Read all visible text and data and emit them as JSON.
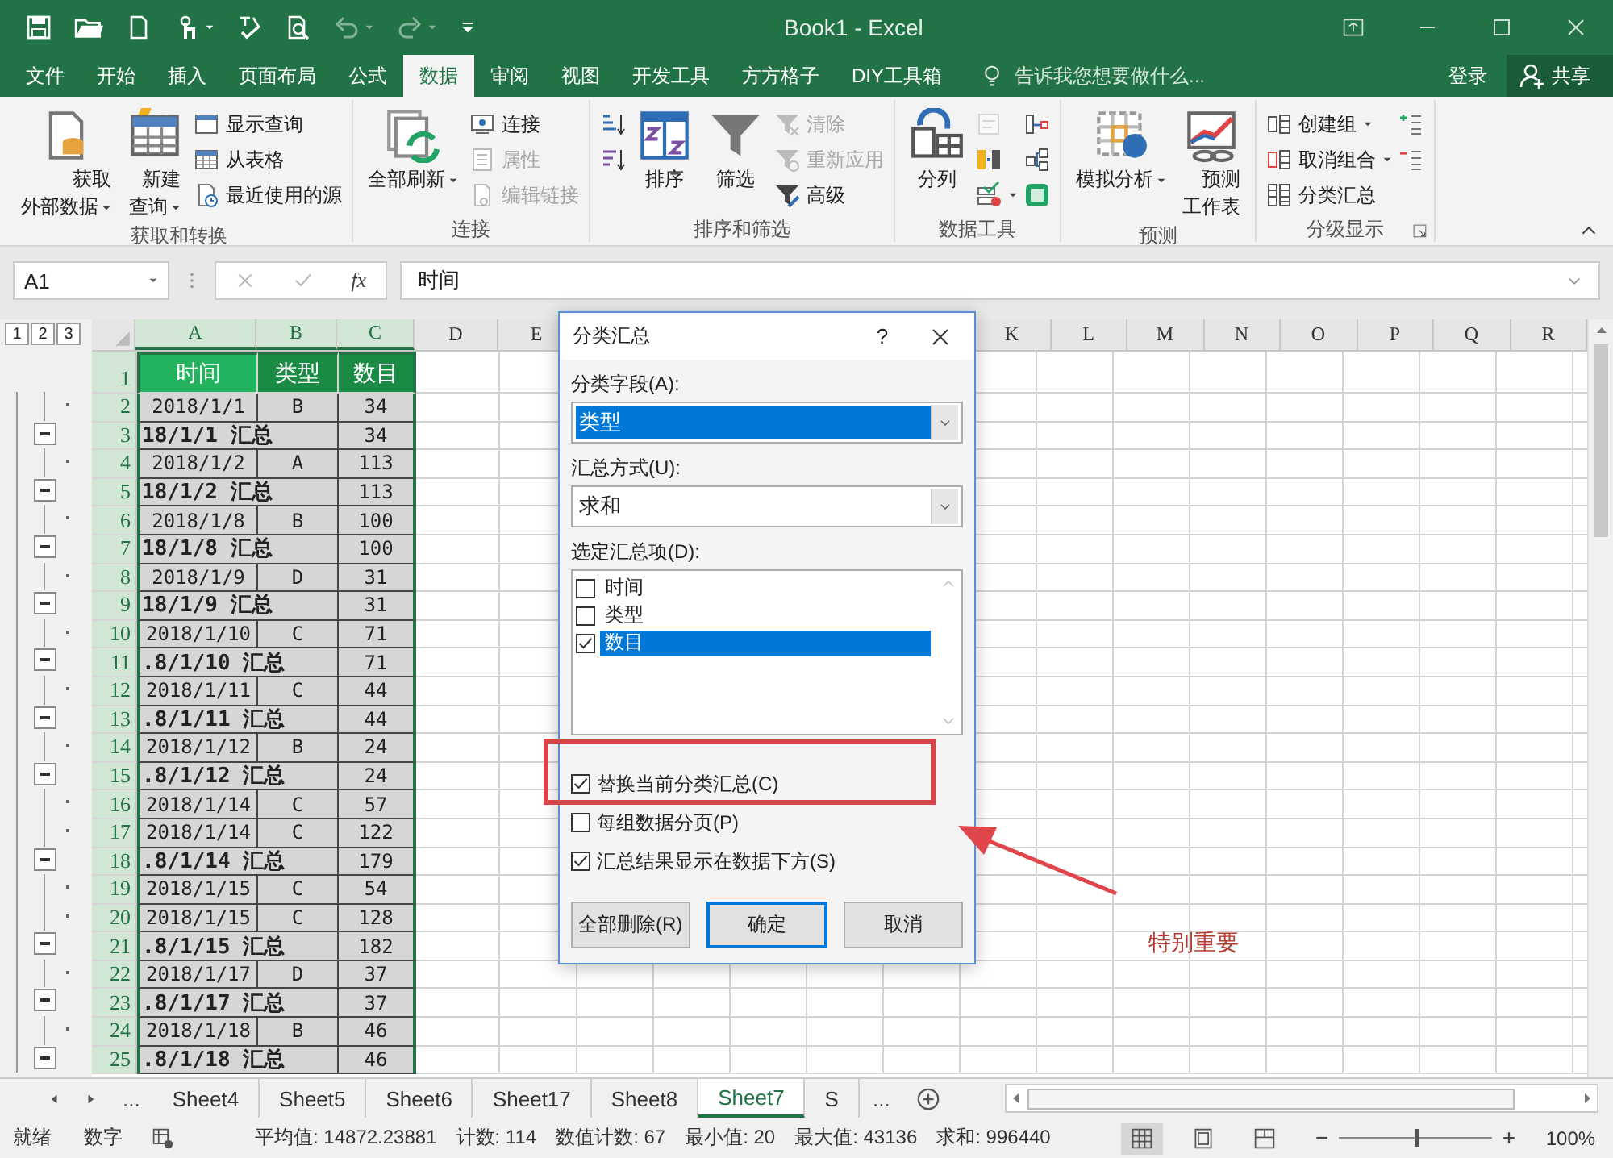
{
  "window": {
    "title": "Book1 - Excel"
  },
  "ribbon_tabs": [
    {
      "label": "文件",
      "selected": false
    },
    {
      "label": "开始",
      "selected": false
    },
    {
      "label": "插入",
      "selected": false
    },
    {
      "label": "页面布局",
      "selected": false
    },
    {
      "label": "公式",
      "selected": false
    },
    {
      "label": "数据",
      "selected": true
    },
    {
      "label": "审阅",
      "selected": false
    },
    {
      "label": "视图",
      "selected": false
    },
    {
      "label": "开发工具",
      "selected": false
    },
    {
      "label": "方方格子",
      "selected": false
    },
    {
      "label": "DIY工具箱",
      "selected": false
    }
  ],
  "tell_me": {
    "placeholder": "告诉我您想要做什么..."
  },
  "account": {
    "sign_in": "登录",
    "share": "共享"
  },
  "ribbon": {
    "groups": [
      {
        "label": "获取和转换",
        "items": [
          {
            "kind": "large",
            "lines": [
              "获取",
              "外部数据"
            ],
            "dropdown": true,
            "disabled": false
          },
          {
            "kind": "large",
            "lines": [
              "新建",
              "查询"
            ],
            "dropdown": true,
            "disabled": false
          },
          {
            "kind": "small",
            "label": "显示查询",
            "dropdown": false,
            "disabled": false
          },
          {
            "kind": "small",
            "label": "从表格",
            "dropdown": false,
            "disabled": false
          },
          {
            "kind": "small",
            "label": "最近使用的源",
            "dropdown": false,
            "disabled": false
          }
        ]
      },
      {
        "label": "连接",
        "items": [
          {
            "kind": "large",
            "lines": [
              "全部刷新"
            ],
            "dropdown": true,
            "disabled": false
          },
          {
            "kind": "small",
            "label": "连接",
            "dropdown": false,
            "disabled": false
          },
          {
            "kind": "small",
            "label": "属性",
            "dropdown": false,
            "disabled": true
          },
          {
            "kind": "small",
            "label": "编辑链接",
            "dropdown": false,
            "disabled": true
          }
        ]
      },
      {
        "label": "排序和筛选",
        "items": [
          {
            "kind": "icon",
            "dropdown": false,
            "disabled": false
          },
          {
            "kind": "icon",
            "dropdown": false,
            "disabled": false
          },
          {
            "kind": "large",
            "lines": [
              "排序"
            ],
            "dropdown": false,
            "disabled": false
          },
          {
            "kind": "large",
            "lines": [
              "筛选"
            ],
            "dropdown": false,
            "disabled": false
          },
          {
            "kind": "small",
            "label": "清除",
            "dropdown": false,
            "disabled": true
          },
          {
            "kind": "small",
            "label": "重新应用",
            "dropdown": false,
            "disabled": true
          },
          {
            "kind": "small",
            "label": "高级",
            "dropdown": false,
            "disabled": false
          }
        ]
      },
      {
        "label": "数据工具",
        "items": [
          {
            "kind": "large",
            "lines": [
              "分列"
            ],
            "dropdown": false,
            "disabled": false
          },
          {
            "kind": "icon",
            "dropdown": false,
            "disabled": true
          },
          {
            "kind": "icon",
            "dropdown": false,
            "disabled": false
          },
          {
            "kind": "icon",
            "dropdown": true,
            "disabled": false
          },
          {
            "kind": "icon",
            "dropdown": false,
            "disabled": false
          },
          {
            "kind": "icon",
            "dropdown": false,
            "disabled": false
          },
          {
            "kind": "icon",
            "dropdown": false,
            "disabled": false
          }
        ]
      },
      {
        "label": "预测",
        "items": [
          {
            "kind": "large",
            "lines": [
              "模拟分析"
            ],
            "dropdown": true,
            "disabled": false
          },
          {
            "kind": "large",
            "lines": [
              "预测",
              "工作表"
            ],
            "dropdown": false,
            "disabled": false
          }
        ]
      },
      {
        "label": "分级显示",
        "launcher": true,
        "items": [
          {
            "kind": "small",
            "label": "创建组",
            "dropdown": true,
            "disabled": false
          },
          {
            "kind": "small",
            "label": "取消组合",
            "dropdown": true,
            "disabled": false
          },
          {
            "kind": "small",
            "label": "分类汇总",
            "dropdown": false,
            "disabled": false
          },
          {
            "kind": "icon",
            "dropdown": false,
            "disabled": false
          },
          {
            "kind": "icon",
            "dropdown": false,
            "disabled": false
          }
        ]
      }
    ]
  },
  "formula_bar": {
    "name_box": "A1",
    "fx": "fx",
    "value": "时间"
  },
  "sheet": {
    "outline_levels": [
      "1",
      "2",
      "3"
    ],
    "columns": [
      {
        "label": "A",
        "selected": true
      },
      {
        "label": "B",
        "selected": true
      },
      {
        "label": "C",
        "selected": true
      },
      {
        "label": "D",
        "selected": false
      },
      {
        "label": "E",
        "selected": false
      },
      {
        "label": "K",
        "selected": false
      },
      {
        "label": "L",
        "selected": false
      },
      {
        "label": "M",
        "selected": false
      },
      {
        "label": "N",
        "selected": false
      },
      {
        "label": "O",
        "selected": false
      },
      {
        "label": "P",
        "selected": false
      },
      {
        "label": "Q",
        "selected": false
      },
      {
        "label": "R",
        "selected": false
      }
    ],
    "header_row": {
      "row": "1",
      "selected": true,
      "cells": [
        "时间",
        "类型",
        "数目"
      ]
    },
    "rows": [
      {
        "row": "2",
        "kind": "detail",
        "selected": true,
        "cells": [
          "2018/1/1",
          "B",
          "34"
        ]
      },
      {
        "row": "3",
        "kind": "summary",
        "selected": true,
        "cells": [
          "18/1/1 汇总",
          "34"
        ]
      },
      {
        "row": "4",
        "kind": "detail",
        "selected": true,
        "cells": [
          "2018/1/2",
          "A",
          "113"
        ]
      },
      {
        "row": "5",
        "kind": "summary",
        "selected": true,
        "cells": [
          "18/1/2 汇总",
          "113"
        ]
      },
      {
        "row": "6",
        "kind": "detail",
        "selected": true,
        "cells": [
          "2018/1/8",
          "B",
          "100"
        ]
      },
      {
        "row": "7",
        "kind": "summary",
        "selected": true,
        "cells": [
          "18/1/8 汇总",
          "100"
        ]
      },
      {
        "row": "8",
        "kind": "detail",
        "selected": true,
        "cells": [
          "2018/1/9",
          "D",
          "31"
        ]
      },
      {
        "row": "9",
        "kind": "summary",
        "selected": true,
        "cells": [
          "18/1/9 汇总",
          "31"
        ]
      },
      {
        "row": "10",
        "kind": "detail",
        "selected": true,
        "cells": [
          "2018/1/10",
          "C",
          "71"
        ]
      },
      {
        "row": "11",
        "kind": "summary",
        "selected": true,
        "cells": [
          ".8/1/10 汇总",
          "71"
        ]
      },
      {
        "row": "12",
        "kind": "detail",
        "selected": true,
        "cells": [
          "2018/1/11",
          "C",
          "44"
        ]
      },
      {
        "row": "13",
        "kind": "summary",
        "selected": true,
        "cells": [
          ".8/1/11 汇总",
          "44"
        ]
      },
      {
        "row": "14",
        "kind": "detail",
        "selected": true,
        "cells": [
          "2018/1/12",
          "B",
          "24"
        ]
      },
      {
        "row": "15",
        "kind": "summary",
        "selected": true,
        "cells": [
          ".8/1/12 汇总",
          "24"
        ]
      },
      {
        "row": "16",
        "kind": "detail",
        "selected": true,
        "cells": [
          "2018/1/14",
          "C",
          "57"
        ]
      },
      {
        "row": "17",
        "kind": "detail",
        "selected": true,
        "cells": [
          "2018/1/14",
          "C",
          "122"
        ]
      },
      {
        "row": "18",
        "kind": "summary",
        "selected": true,
        "cells": [
          ".8/1/14 汇总",
          "179"
        ]
      },
      {
        "row": "19",
        "kind": "detail",
        "selected": true,
        "cells": [
          "2018/1/15",
          "C",
          "54"
        ]
      },
      {
        "row": "20",
        "kind": "detail",
        "selected": true,
        "cells": [
          "2018/1/15",
          "C",
          "128"
        ]
      },
      {
        "row": "21",
        "kind": "summary",
        "selected": true,
        "cells": [
          ".8/1/15 汇总",
          "182"
        ]
      },
      {
        "row": "22",
        "kind": "detail",
        "selected": true,
        "cells": [
          "2018/1/17",
          "D",
          "37"
        ]
      },
      {
        "row": "23",
        "kind": "summary",
        "selected": true,
        "cells": [
          ".8/1/17 汇总",
          "37"
        ]
      },
      {
        "row": "24",
        "kind": "detail",
        "selected": true,
        "cells": [
          "2018/1/18",
          "B",
          "46"
        ]
      },
      {
        "row": "25",
        "kind": "summary",
        "selected": true,
        "cells": [
          ".8/1/18 汇总",
          "46"
        ]
      }
    ]
  },
  "dialog": {
    "title": "分类汇总",
    "help": "?",
    "field_label": "分类字段(A):",
    "field_value": "类型",
    "method_label": "汇总方式(U):",
    "method_value": "求和",
    "items_label": "选定汇总项(D):",
    "items": [
      {
        "label": "时间",
        "checked": false,
        "selected": false
      },
      {
        "label": "类型",
        "checked": false,
        "selected": false
      },
      {
        "label": "数目",
        "checked": true,
        "selected": true
      }
    ],
    "options": [
      {
        "label": "替换当前分类汇总(C)",
        "checked": true
      },
      {
        "label": "每组数据分页(P)",
        "checked": false
      },
      {
        "label": "汇总结果显示在数据下方(S)",
        "checked": true
      }
    ],
    "buttons": [
      {
        "label": "全部删除(R)",
        "default": false
      },
      {
        "label": "确定",
        "default": true
      },
      {
        "label": "取消",
        "default": false
      }
    ]
  },
  "annotation": {
    "text": "特别重要"
  },
  "sheet_tabs": {
    "more_left": "...",
    "tabs": [
      {
        "label": "Sheet4",
        "selected": false
      },
      {
        "label": "Sheet5",
        "selected": false
      },
      {
        "label": "Sheet6",
        "selected": false
      },
      {
        "label": "Sheet17",
        "selected": false
      },
      {
        "label": "Sheet8",
        "selected": false
      },
      {
        "label": "Sheet7",
        "selected": true
      },
      {
        "label": "S",
        "selected": false
      }
    ],
    "more_right": "..."
  },
  "status_bar": {
    "mode": "就绪",
    "num_lock": "数字",
    "stats": [
      "平均值: 14872.23881",
      "计数: 114",
      "数值计数: 67",
      "最小值: 20",
      "最大值: 43136",
      "求和: 996440"
    ],
    "zoom": {
      "level": 0.5,
      "percent": "100%"
    }
  }
}
